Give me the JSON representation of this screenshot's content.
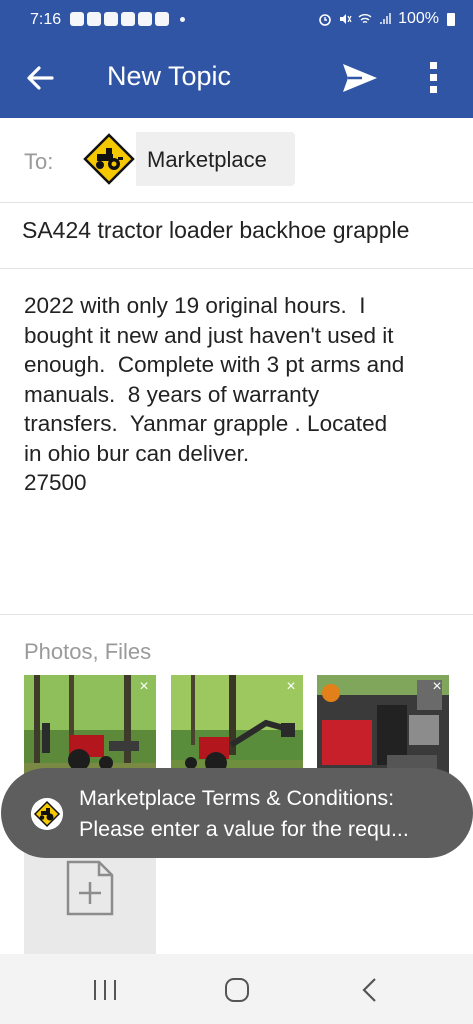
{
  "status_bar": {
    "time": "7:16",
    "battery": "100%",
    "left_icons": [
      "threads-icon",
      "youtube-icon",
      "tiktok-icon",
      "tiktok-icon",
      "calendar-icon",
      "check-icon",
      "dot-icon"
    ],
    "right_icons": [
      "alarm-icon",
      "mute-icon",
      "wifi-icon",
      "signal-icon",
      "battery-icon"
    ]
  },
  "app_bar": {
    "title": "New Topic",
    "color": "#2f55a4"
  },
  "compose": {
    "to_label": "To:",
    "recipient": "Marketplace",
    "subject": "SA424 tractor loader backhoe grapple",
    "body": "2022 with only 19 original hours.  I\nbought it new and just haven't used it\nenough.  Complete with 3 pt arms and\nmanuals.  8 years of warranty\ntransfers.  Yanmar grapple . Located\nin ohio bur can deliver.\n27500"
  },
  "attachments": {
    "label": "Photos, Files",
    "photos": [
      {
        "name": "photo-1",
        "remove_label": "×"
      },
      {
        "name": "photo-2",
        "remove_label": "×"
      },
      {
        "name": "photo-3",
        "remove_label": "×"
      }
    ]
  },
  "toast": {
    "line1": "Marketplace Terms & Conditions:",
    "line2": "Please enter a value for the requ..."
  },
  "nav_bar": {
    "buttons": [
      "recent-apps",
      "home",
      "back"
    ]
  }
}
